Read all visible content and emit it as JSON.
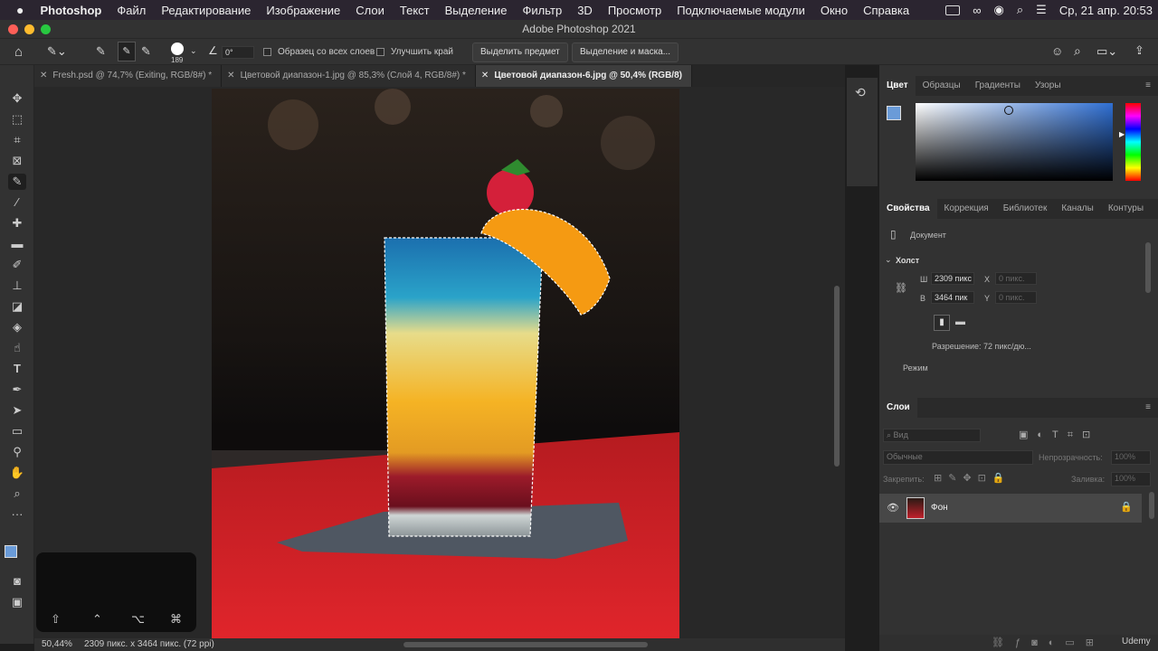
{
  "menubar": {
    "apple": "",
    "app_name": "Photoshop",
    "items": [
      "Файл",
      "Редактирование",
      "Изображение",
      "Слои",
      "Текст",
      "Выделение",
      "Фильтр",
      "3D",
      "Просмотр",
      "Подключаемые модули",
      "Окно",
      "Справка"
    ],
    "datetime": "Ср, 21 апр.  20:53"
  },
  "window": {
    "title": "Adobe Photoshop 2021"
  },
  "options": {
    "brush_size": "189",
    "angle": "0°",
    "sample_all_layers": "Образец со всех слоев",
    "enhance_edge": "Улучшить край",
    "select_subject": "Выделить предмет",
    "select_and_mask": "Выделение и маска..."
  },
  "tabs": [
    {
      "label": "Fresh.psd @ 74,7% (Exiting, RGB/8#) *",
      "active": false
    },
    {
      "label": "Цветовой диапазон-1.jpg @ 85,3% (Слой 4, RGB/8#) *",
      "active": false
    },
    {
      "label": "Цветовой диапазон-6.jpg @ 50,4% (RGB/8)",
      "active": true
    }
  ],
  "status": {
    "zoom": "50,44%",
    "info": "2309 пикс. x 3464 пикс. (72 ppi)"
  },
  "color_panel": {
    "tabs": [
      "Цвет",
      "Образцы",
      "Градиенты",
      "Узоры"
    ],
    "fg_color": "#6a9bd8"
  },
  "properties": {
    "tabs": [
      "Свойства",
      "Коррекция",
      "Библиотек",
      "Каналы",
      "Контуры"
    ],
    "type": "Документ",
    "section": "Холст",
    "w_label": "Ш",
    "w_value": "2309 пикс",
    "x_label": "X",
    "x_value": "0 пикс.",
    "h_label": "В",
    "h_value": "3464 пик",
    "y_label": "Y",
    "y_value": "0 пикс.",
    "resolution": "Разрешение: 72 пикс/дю...",
    "mode": "Режим"
  },
  "layers": {
    "title": "Слои",
    "search": "Вид",
    "blend": "Обычные",
    "opacity_label": "Непрозрачность:",
    "opacity": "100%",
    "lock_label": "Закрепить:",
    "fill_label": "Заливка:",
    "fill": "100%",
    "items": [
      {
        "name": "Фон"
      }
    ]
  },
  "watermark": "Udemy"
}
